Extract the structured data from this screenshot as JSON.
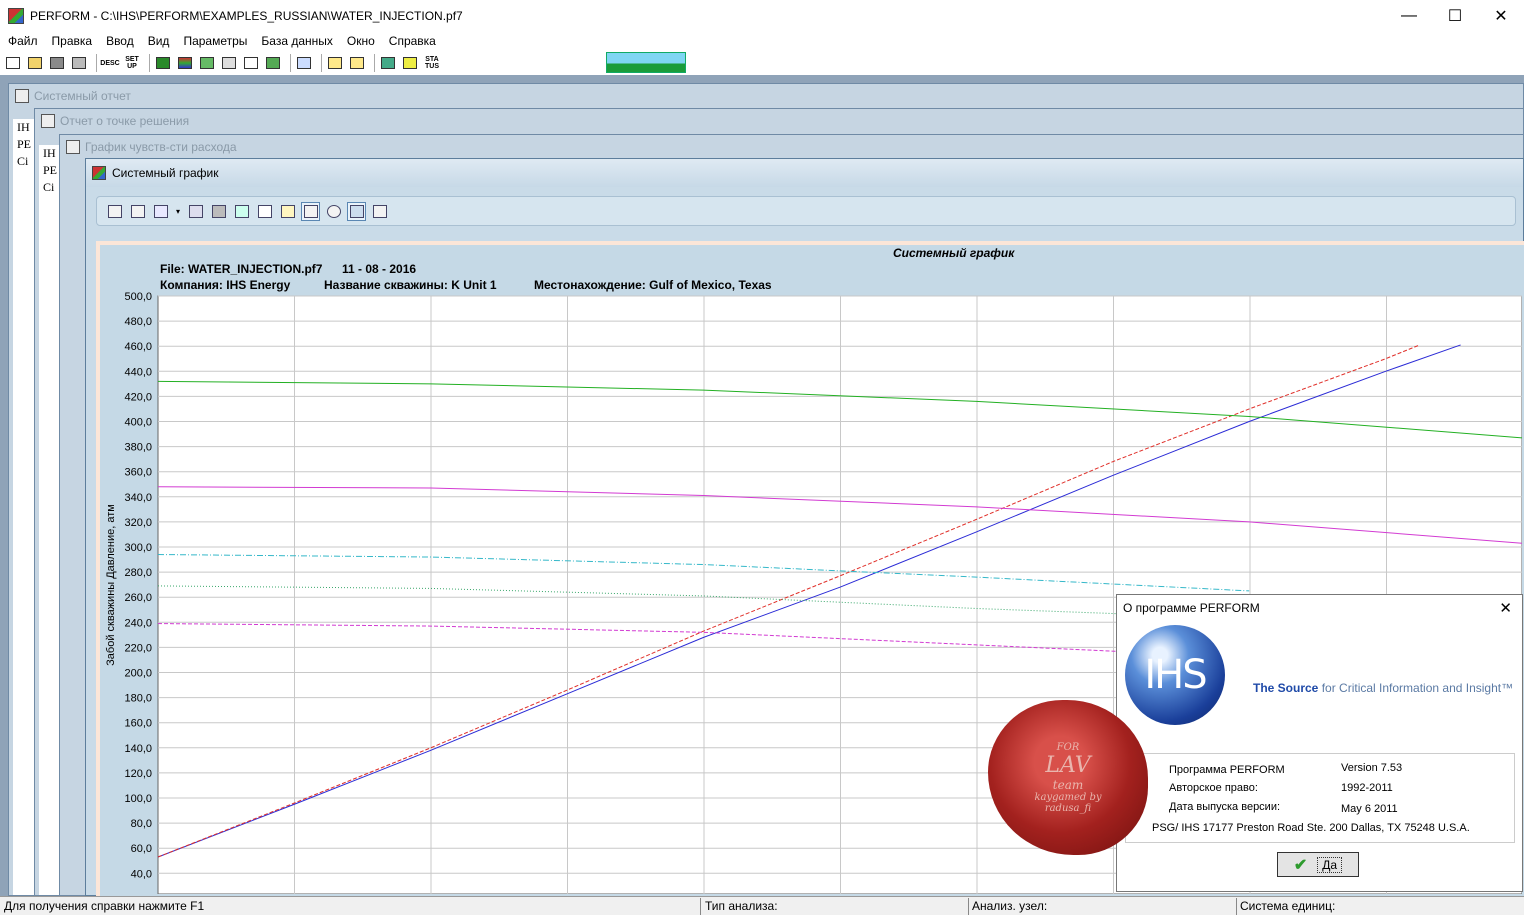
{
  "window": {
    "title": "PERFORM - C:\\IHS\\PERFORM\\EXAMPLES_RUSSIAN\\WATER_INJECTION.pf7",
    "minimize": "—",
    "maximize": "☐",
    "close": "✕"
  },
  "menu": [
    "Файл",
    "Правка",
    "Ввод",
    "Вид",
    "Параметры",
    "База данных",
    "Окно",
    "Справка"
  ],
  "toolbar": {
    "desc_label": "DESC",
    "setup_label": "SET UP",
    "status_label": "STA TUS"
  },
  "child_windows": {
    "system_report": "Системный отчет",
    "solution_point_report": "Отчет о точке решения",
    "rate_sensitivity_plot": "График чувств-сти расхода",
    "system_plot": "Системный график"
  },
  "left_stub_text": [
    "IH",
    "PE",
    "Сі"
  ],
  "chart_header": {
    "file": "File: WATER_INJECTION.pf7",
    "date": "11 - 08 - 2016",
    "company": "Компания: IHS Energy",
    "well": "Название скважины: K Unit 1",
    "location": "Местонахождение: Gulf of Mexico, Texas"
  },
  "chart_data": {
    "type": "line",
    "title": "Системный график",
    "ylabel": "Забой скважины Давление, атм",
    "xlabel": "",
    "ylim": [
      40,
      500
    ],
    "yticks": [
      "500,0",
      "480,0",
      "460,0",
      "440,0",
      "420,0",
      "400,0",
      "380,0",
      "360,0",
      "340,0",
      "320,0",
      "300,0",
      "280,0",
      "260,0",
      "240,0",
      "220,0",
      "200,0",
      "180,0",
      "160,0",
      "140,0",
      "120,0",
      "100,0",
      "80,0",
      "60,0",
      "40,0"
    ],
    "xlim": [
      0,
      10
    ],
    "grid": true,
    "series": [
      {
        "color": "#2b2bd6",
        "dash": "solid",
        "x": [
          0,
          1,
          2,
          3,
          4,
          5,
          6,
          7,
          8,
          9,
          9.55
        ],
        "y": [
          53,
          95,
          138,
          183,
          228,
          268,
          312,
          357,
          400,
          440,
          461
        ]
      },
      {
        "color": "#e0302a",
        "dash": "dash",
        "x": [
          0,
          1,
          2,
          3,
          4,
          5,
          6,
          7,
          8,
          9,
          9.25
        ],
        "y": [
          53,
          96,
          140,
          186,
          233,
          277,
          322,
          368,
          410,
          450,
          461
        ]
      },
      {
        "color": "#23b023",
        "dash": "solid",
        "x": [
          0,
          2,
          4,
          6,
          8,
          10
        ],
        "y": [
          432,
          430,
          425,
          416,
          404,
          387
        ]
      },
      {
        "color": "#d23bd2",
        "dash": "solid",
        "x": [
          0,
          2,
          4,
          6,
          8,
          10
        ],
        "y": [
          348,
          347,
          341,
          332,
          320,
          303
        ]
      },
      {
        "color": "#35b8c9",
        "dash": "dashdot",
        "x": [
          0,
          2,
          4,
          6,
          8
        ],
        "y": [
          294,
          292,
          286,
          276,
          265
        ]
      },
      {
        "color": "#3aa76b",
        "dash": "dot",
        "x": [
          0,
          2,
          4,
          6,
          8
        ],
        "y": [
          269,
          267,
          261,
          251,
          243
        ]
      },
      {
        "color": "#d23bd2",
        "dash": "dash",
        "x": [
          0,
          2,
          4,
          6,
          8
        ],
        "y": [
          239,
          237,
          232,
          222,
          212
        ]
      }
    ]
  },
  "about_dialog": {
    "title": "О программе PERFORM",
    "close": "✕",
    "logo_text": "IHS",
    "tagline_bold": "The Source",
    "tagline_rest": "for Critical Information and Insight™",
    "program_label": "Программа PERFORM",
    "program_value": "Version 7.53",
    "copyright_label": "Авторское право:",
    "copyright_value": "1992-2011",
    "release_label": "Дата выпуска версии:",
    "release_value": "May  6 2011",
    "address": "PSG/ IHS  17177 Preston Road Ste. 200  Dallas, TX  75248  U.S.A.",
    "ok_label": "Да"
  },
  "seal": {
    "line1": "LAV",
    "line2": "team",
    "line3": "kaygamed by",
    "line4": "radusa_fi",
    "ring": "FOR"
  },
  "statusbar": {
    "help": "Для получения справки нажмите F1",
    "analysis_type": "Тип анализа:",
    "analysis_node": "Анализ. узел:",
    "unit_system": "Система единиц:"
  }
}
